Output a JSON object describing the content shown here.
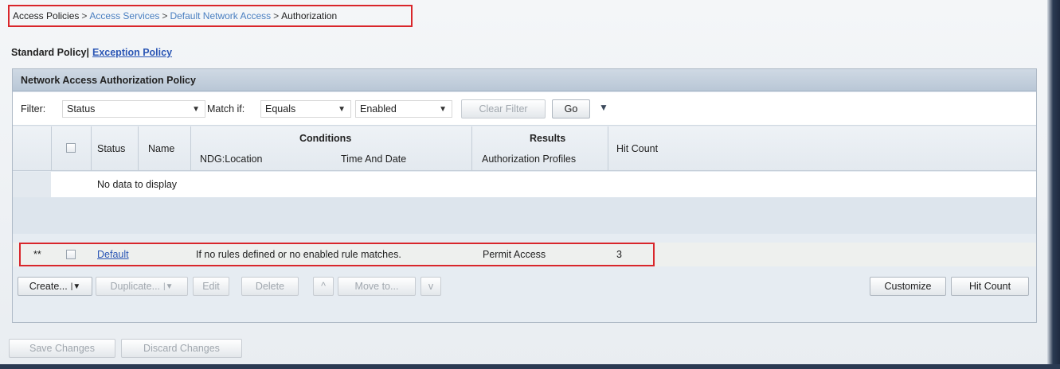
{
  "breadcrumb": {
    "items": [
      {
        "label": "Access Policies",
        "type": "current"
      },
      {
        "label": "Access Services",
        "type": "link"
      },
      {
        "label": "Default Network Access",
        "type": "link"
      },
      {
        "label": "Authorization",
        "type": "current"
      }
    ],
    "separator": ">"
  },
  "policy_tabs": {
    "standard": "Standard Policy",
    "separator": "|",
    "exception": "Exception Policy"
  },
  "panel": {
    "title": "Network Access Authorization Policy"
  },
  "filter": {
    "filter_label": "Filter:",
    "filter_value": "Status",
    "match_label": "Match if:",
    "match_value": "Equals",
    "value": "Enabled",
    "clear_filter": "Clear Filter",
    "go": "Go"
  },
  "grid": {
    "columns": {
      "status": "Status",
      "name": "Name",
      "conditions_group": "Conditions",
      "ndg_location": "NDG:Location",
      "time_and_date": "Time And Date",
      "results_group": "Results",
      "authorization_profiles": "Authorization Profiles",
      "hit_count": "Hit Count"
    },
    "empty_message": "No data to display"
  },
  "default_rule": {
    "marker": "**",
    "name": "Default",
    "condition": "If no rules defined or no enabled rule matches.",
    "result": "Permit Access",
    "hit_count": "3"
  },
  "actions": {
    "create": "Create...",
    "duplicate": "Duplicate...",
    "edit": "Edit",
    "delete": "Delete",
    "move_up": "^",
    "move_to": "Move to...",
    "move_down": "v",
    "customize": "Customize",
    "hit_count": "Hit Count"
  },
  "footer": {
    "save_changes": "Save Changes",
    "discard_changes": "Discard Changes"
  },
  "colors": {
    "highlight_border": "#d9262b",
    "link": "#2b56b5",
    "breadcrumb_link": "#4a7fc1",
    "panel_header": "#b9c7d6"
  }
}
